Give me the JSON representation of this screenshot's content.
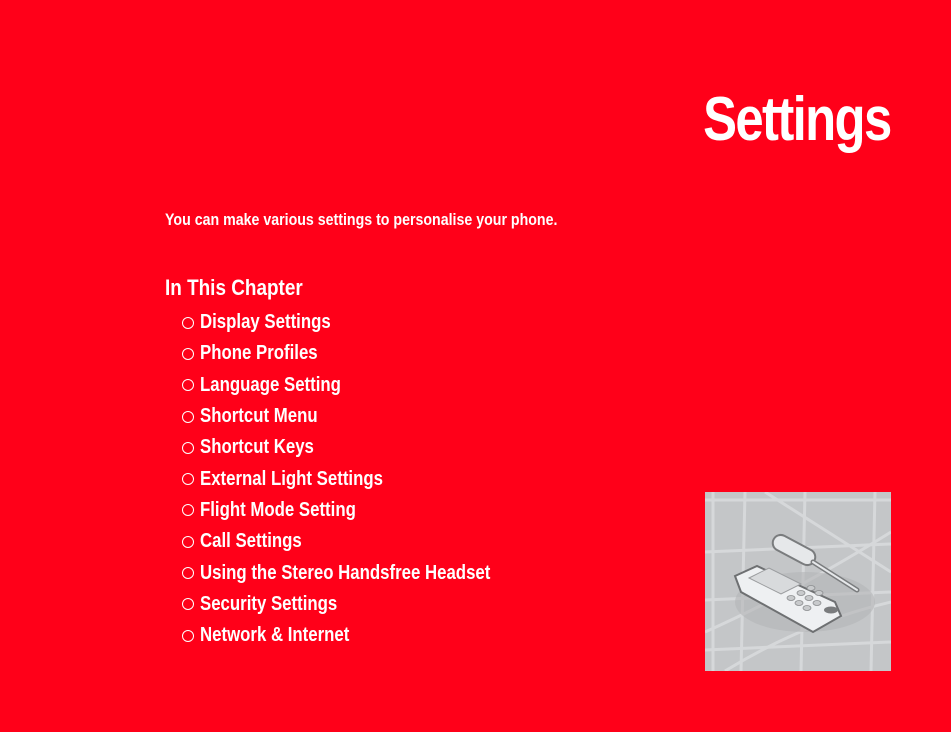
{
  "page": {
    "title": "Settings",
    "intro": "You can make various settings to personalise your phone.",
    "chapter_heading": "In This Chapter",
    "bullet_icon": "hollow-circle-bullet-icon",
    "colors": {
      "background": "#ff0019",
      "text": "#ffffff",
      "illustration_bg": "#c4c6c8"
    },
    "chapter_items": [
      {
        "label": "Display Settings"
      },
      {
        "label": "Phone Profiles"
      },
      {
        "label": "Language Setting"
      },
      {
        "label": "Shortcut Menu"
      },
      {
        "label": "Shortcut Keys"
      },
      {
        "label": "External Light Settings"
      },
      {
        "label": "Flight Mode Setting"
      },
      {
        "label": "Call Settings"
      },
      {
        "label": "Using the Stereo Handsfree Headset"
      },
      {
        "label": "Security Settings"
      },
      {
        "label": "Network & Internet"
      }
    ],
    "illustration": {
      "description": "phone-and-screwdriver-icon"
    }
  }
}
